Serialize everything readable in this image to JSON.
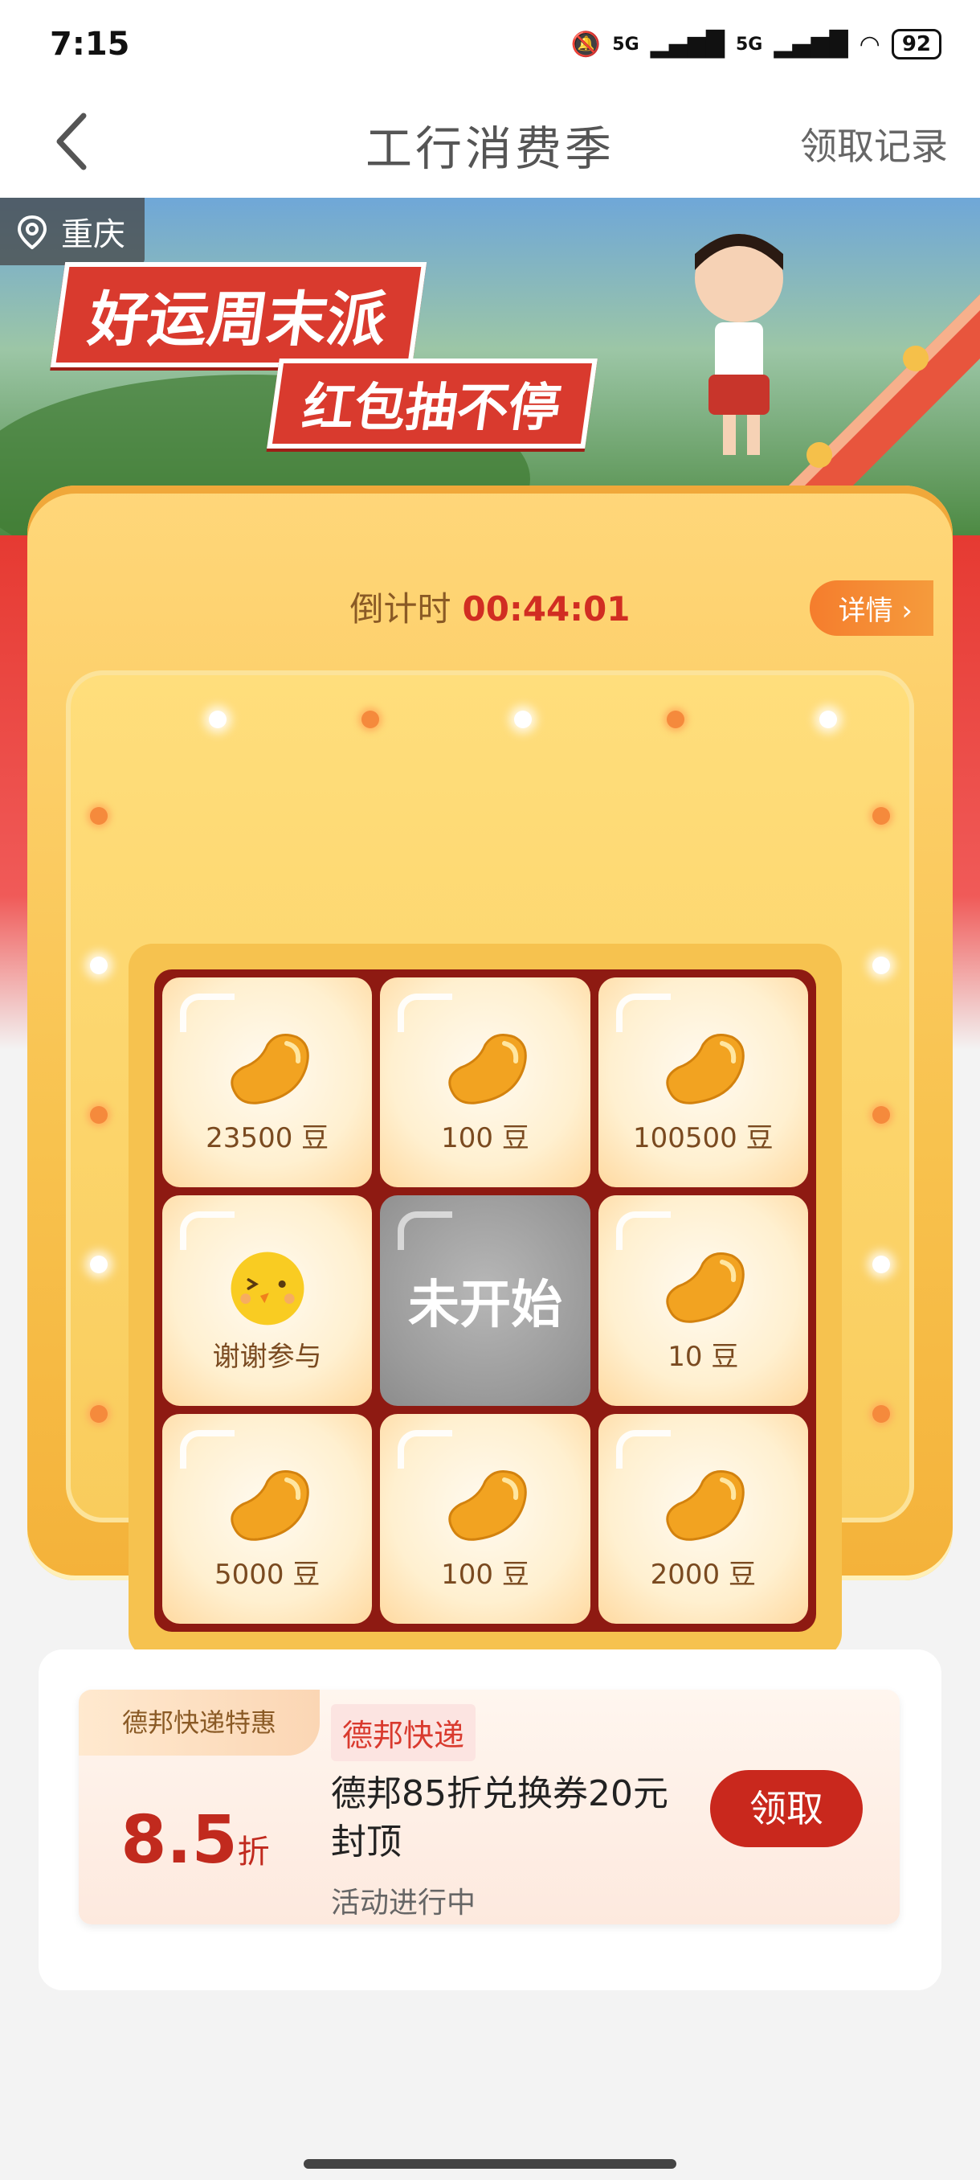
{
  "status_bar": {
    "time": "7:15",
    "signal1": "5G",
    "signal2": "5G",
    "battery": "92"
  },
  "nav": {
    "title": "工行消费季",
    "record": "领取记录"
  },
  "banner": {
    "location": "重庆",
    "slogan1": "好运周末派",
    "slogan2": "红包抽不停"
  },
  "lottery": {
    "countdown_label": "倒计时",
    "countdown_value": "00:44:01",
    "detail": "详情",
    "cells": [
      {
        "label": "23500 豆",
        "icon": "bean-icon"
      },
      {
        "label": "100 豆",
        "icon": "bean-icon"
      },
      {
        "label": "100500 豆",
        "icon": "bean-icon"
      },
      {
        "label": "谢谢参与",
        "icon": "chick-icon"
      },
      {
        "label": "未开始",
        "icon": ""
      },
      {
        "label": "10 豆",
        "icon": "bean-icon"
      },
      {
        "label": "5000 豆",
        "icon": "bean-icon"
      },
      {
        "label": "100 豆",
        "icon": "bean-icon"
      },
      {
        "label": "2000 豆",
        "icon": "bean-icon"
      }
    ]
  },
  "coupon": {
    "tag": "德邦快递特惠",
    "discount": "8.5",
    "discount_unit": "折",
    "brand": "德邦快递",
    "description": "德邦85折兑换券20元封顶",
    "status": "活动进行中",
    "claim": "领取"
  },
  "colors": {
    "accent_red": "#c9281d",
    "gold": "#f8c24e"
  }
}
